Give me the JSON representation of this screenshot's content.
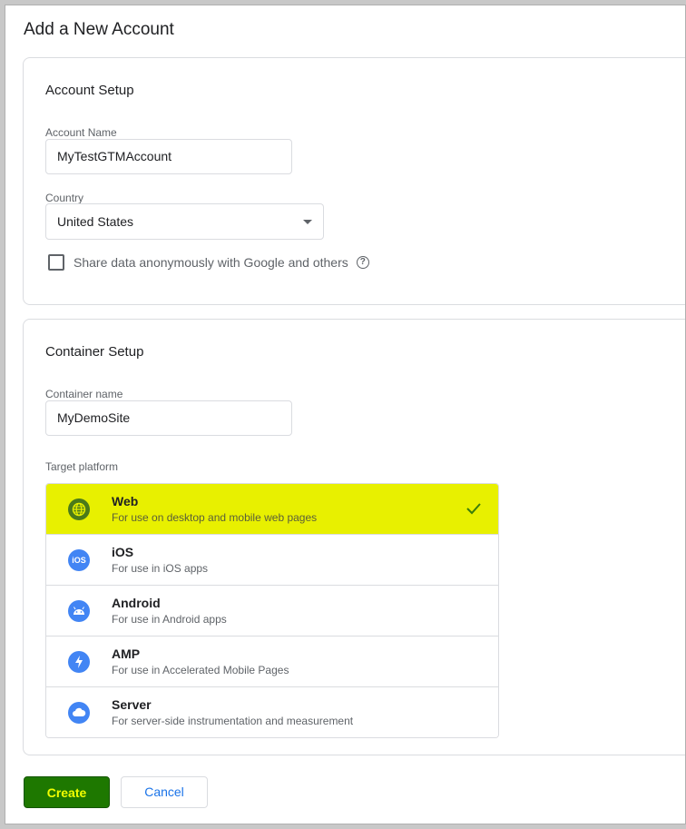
{
  "page": {
    "title": "Add a New Account"
  },
  "account_setup": {
    "section_title": "Account Setup",
    "account_name_label": "Account Name",
    "account_name_value": "MyTestGTMAccount",
    "country_label": "Country",
    "country_value": "United States",
    "share_data_label": "Share data anonymously with Google and others",
    "share_data_checked": false
  },
  "container_setup": {
    "section_title": "Container Setup",
    "container_name_label": "Container name",
    "container_name_value": "MyDemoSite",
    "target_platform_label": "Target platform",
    "platforms": [
      {
        "name": "Web",
        "description": "For use on desktop and mobile web pages",
        "icon": "globe-icon",
        "selected": true
      },
      {
        "name": "iOS",
        "description": "For use in iOS apps",
        "icon": "ios-icon",
        "selected": false
      },
      {
        "name": "Android",
        "description": "For use in Android apps",
        "icon": "android-icon",
        "selected": false
      },
      {
        "name": "AMP",
        "description": "For use in Accelerated Mobile Pages",
        "icon": "amp-bolt-icon",
        "selected": false
      },
      {
        "name": "Server",
        "description": "For server-side instrumentation and measurement",
        "icon": "cloud-icon",
        "selected": false
      }
    ]
  },
  "actions": {
    "create_label": "Create",
    "cancel_label": "Cancel"
  },
  "colors": {
    "selected_highlight": "#e8f000",
    "create_button_bg": "#1e7800",
    "create_button_text": "#f2ff00",
    "accent_blue": "#4285f4",
    "link_blue": "#1a73e8"
  }
}
